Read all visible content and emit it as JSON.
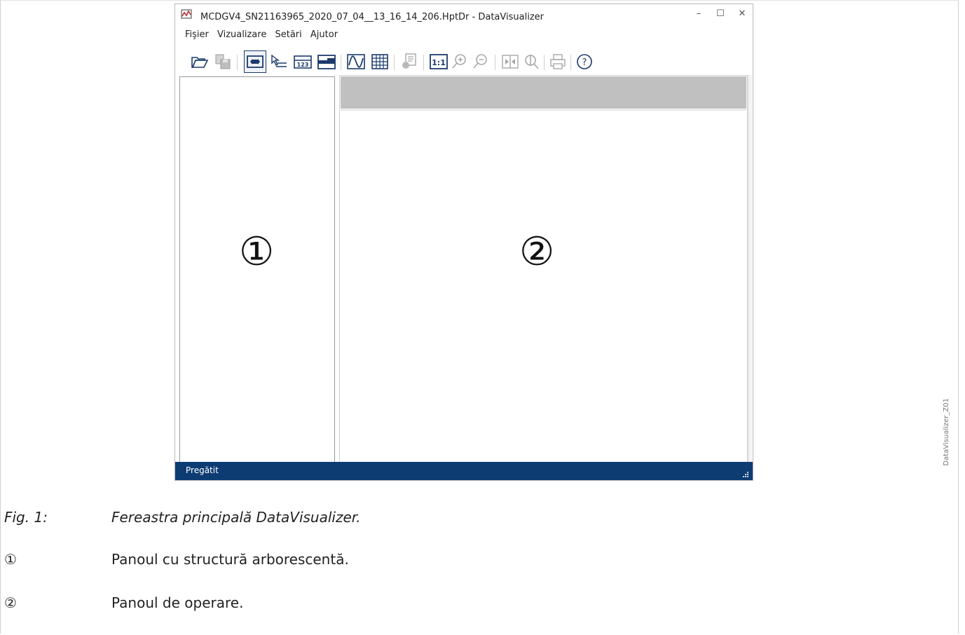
{
  "window": {
    "title": "MCDGV4_SN21163965_2020_07_04__13_16_14_206.HptDr - DataVisualizer",
    "controls": {
      "minimize": "–",
      "maximize": "☐",
      "close": "✕"
    }
  },
  "menu": [
    {
      "label": "Fişier"
    },
    {
      "label": "Vizualizare"
    },
    {
      "label": "Setări"
    },
    {
      "label": "Ajutor"
    }
  ],
  "toolbar": {
    "buttons": [
      {
        "icon": "open-folder-icon"
      },
      {
        "icon": "save-icon",
        "enabled": false
      },
      {
        "icon": "view-mode-icon",
        "active": true
      },
      {
        "icon": "cursor-select-icon"
      },
      {
        "icon": "numeric-values-icon",
        "text": "123"
      },
      {
        "icon": "digital-signals-icon"
      },
      {
        "icon": "waveform-icon"
      },
      {
        "icon": "table-grid-icon"
      },
      {
        "icon": "report-icon",
        "enabled": false
      },
      {
        "icon": "zoom-one-to-one-icon",
        "text": "1:1"
      },
      {
        "icon": "zoom-in-icon",
        "enabled": false
      },
      {
        "icon": "zoom-out-icon",
        "enabled": false
      },
      {
        "icon": "fit-horizontal-icon",
        "enabled": false
      },
      {
        "icon": "phasor-icon",
        "enabled": false
      },
      {
        "icon": "print-icon",
        "enabled": false
      },
      {
        "icon": "help-icon",
        "text": "?"
      }
    ]
  },
  "panels": {
    "tree_marker": "①",
    "operation_marker": "②"
  },
  "statusbar": {
    "text": "Pregătit"
  },
  "side_label": "DataVisualizer_Z01",
  "captions": {
    "figure": {
      "label": "Fig. 1:",
      "text": "Fereastra principală DataVisualizer."
    },
    "items": [
      {
        "marker": "①",
        "text": "Panoul cu structură arborescentă."
      },
      {
        "marker": "②",
        "text": "Panoul de operare."
      }
    ]
  },
  "colors": {
    "statusbar": "#0d3c73",
    "toolbar_icon": "#1b3a6b",
    "operation_header": "#c0c0c0"
  }
}
